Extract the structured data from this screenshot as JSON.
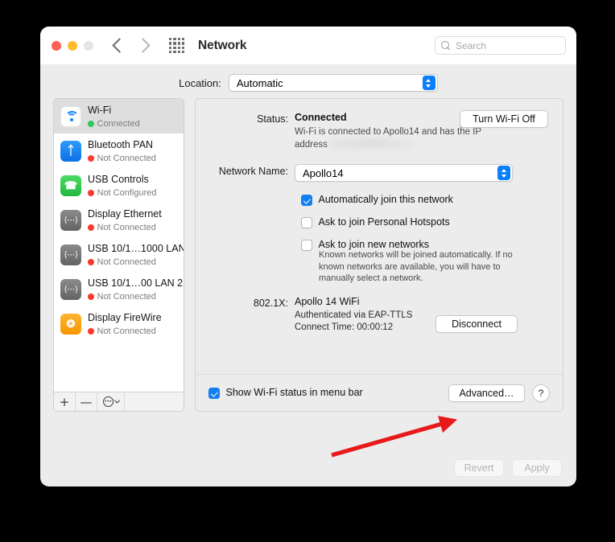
{
  "window": {
    "title": "Network",
    "traffic_lights": [
      "close",
      "minimize",
      "zoom"
    ],
    "nav_back_icon": "chevron-left-icon",
    "nav_forward_icon": "chevron-forward-icon",
    "grid_icon": "show-all-grid-icon",
    "search": {
      "placeholder": "Search",
      "value": "",
      "icon": "search-icon"
    }
  },
  "location": {
    "label": "Location:",
    "value": "Automatic"
  },
  "sidebar": {
    "services": [
      {
        "name": "Wi-Fi",
        "status": "Connected",
        "state": "connected",
        "icon": "wifi-icon",
        "selected": true
      },
      {
        "name": "Bluetooth PAN",
        "status": "Not Connected",
        "state": "off",
        "icon": "bluetooth-icon",
        "selected": false
      },
      {
        "name": "USB Controls",
        "status": "Not Configured",
        "state": "off",
        "icon": "usb-modem-icon",
        "selected": false
      },
      {
        "name": "Display Ethernet",
        "status": "Not Connected",
        "state": "off",
        "icon": "ethernet-icon",
        "selected": false
      },
      {
        "name": "USB 10/1…1000 LAN",
        "status": "Not Connected",
        "state": "off",
        "icon": "ethernet-icon",
        "selected": false
      },
      {
        "name": "USB 10/1…00 LAN 2",
        "status": "Not Connected",
        "state": "off",
        "icon": "ethernet-icon",
        "selected": false
      },
      {
        "name": "Display FireWire",
        "status": "Not Connected",
        "state": "off",
        "icon": "firewire-icon",
        "selected": false
      }
    ],
    "toolbar": {
      "add_label": "+",
      "remove_label": "—",
      "action_icon": "action-gear-icon",
      "action_chevron_icon": "chevron-down-icon"
    }
  },
  "main": {
    "status": {
      "label": "Status:",
      "value": "Connected",
      "toggle_button": "Turn Wi-Fi Off",
      "description_prefix": "Wi-Fi is connected to Apollo14 and has the IP address",
      "description_redacted": true
    },
    "network_name": {
      "label": "Network Name:",
      "value": "Apollo14"
    },
    "checkboxes": [
      {
        "label": "Automatically join this network",
        "checked": true
      },
      {
        "label": "Ask to join Personal Hotspots",
        "checked": false
      },
      {
        "label": "Ask to join new networks",
        "checked": false
      }
    ],
    "checkbox_help": "Known networks will be joined automatically. If no known networks are available, you will have to manually select a network.",
    "dot1x": {
      "label": "802.1X:",
      "profile": "Apollo 14 WiFi",
      "disconnect_button": "Disconnect",
      "auth_line": "Authenticated via EAP-TTLS",
      "time_line": "Connect Time: 00:00:12"
    },
    "bottom_bar": {
      "menu_bar_checkbox": {
        "label": "Show Wi-Fi status in menu bar",
        "checked": true
      },
      "advanced_button": "Advanced…",
      "help_button": "?"
    }
  },
  "footer": {
    "revert_button": "Revert",
    "apply_button": "Apply",
    "revert_enabled": false,
    "apply_enabled": false
  },
  "annotation": {
    "type": "arrow",
    "color": "#e8191b",
    "points_to": "advanced-button"
  },
  "colors": {
    "accent_blue": "#127ef1",
    "connected_green": "#34c759",
    "not_connected_red": "#fc3b30",
    "annotation_red": "#e8191b",
    "window_bg": "#ececec",
    "titlebar_bg": "#ffffff"
  }
}
